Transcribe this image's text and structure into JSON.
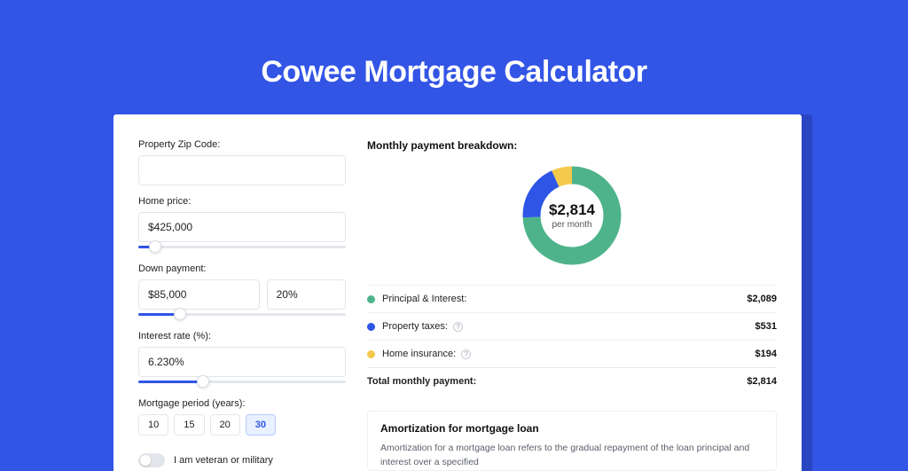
{
  "header": {
    "title": "Cowee Mortgage Calculator"
  },
  "form": {
    "zip_label": "Property Zip Code:",
    "zip_value": "",
    "home_price_label": "Home price:",
    "home_price_value": "$425,000",
    "down_payment_label": "Down payment:",
    "down_payment_value": "$85,000",
    "down_payment_pct": "20%",
    "interest_label": "Interest rate (%):",
    "interest_value": "6.230%",
    "period_label": "Mortgage period (years):",
    "period_options": [
      "10",
      "15",
      "20",
      "30"
    ],
    "period_selected": "30",
    "veteran_label": "I am veteran or military",
    "slider_home_price_pct": 8,
    "slider_down_payment_pct": 20,
    "slider_interest_pct": 31
  },
  "breakdown": {
    "title": "Monthly payment breakdown:",
    "center_amount": "$2,814",
    "center_sub": "per month",
    "items": [
      {
        "label": "Principal & Interest:",
        "value": "$2,089",
        "color": "green",
        "info": false
      },
      {
        "label": "Property taxes:",
        "value": "$531",
        "color": "blue",
        "info": true
      },
      {
        "label": "Home insurance:",
        "value": "$194",
        "color": "yellow",
        "info": true
      }
    ],
    "total_label": "Total monthly payment:",
    "total_value": "$2,814"
  },
  "amort": {
    "title": "Amortization for mortgage loan",
    "text": "Amortization for a mortgage loan refers to the gradual repayment of the loan principal and interest over a specified"
  },
  "chart_data": {
    "type": "pie",
    "title": "Monthly payment breakdown",
    "series": [
      {
        "name": "Principal & Interest",
        "value": 2089,
        "color": "#4eb38a"
      },
      {
        "name": "Property taxes",
        "value": 531,
        "color": "#2f55e6"
      },
      {
        "name": "Home insurance",
        "value": 194,
        "color": "#f2c94c"
      }
    ],
    "total": 2814,
    "center_label": "$2,814 per month"
  }
}
